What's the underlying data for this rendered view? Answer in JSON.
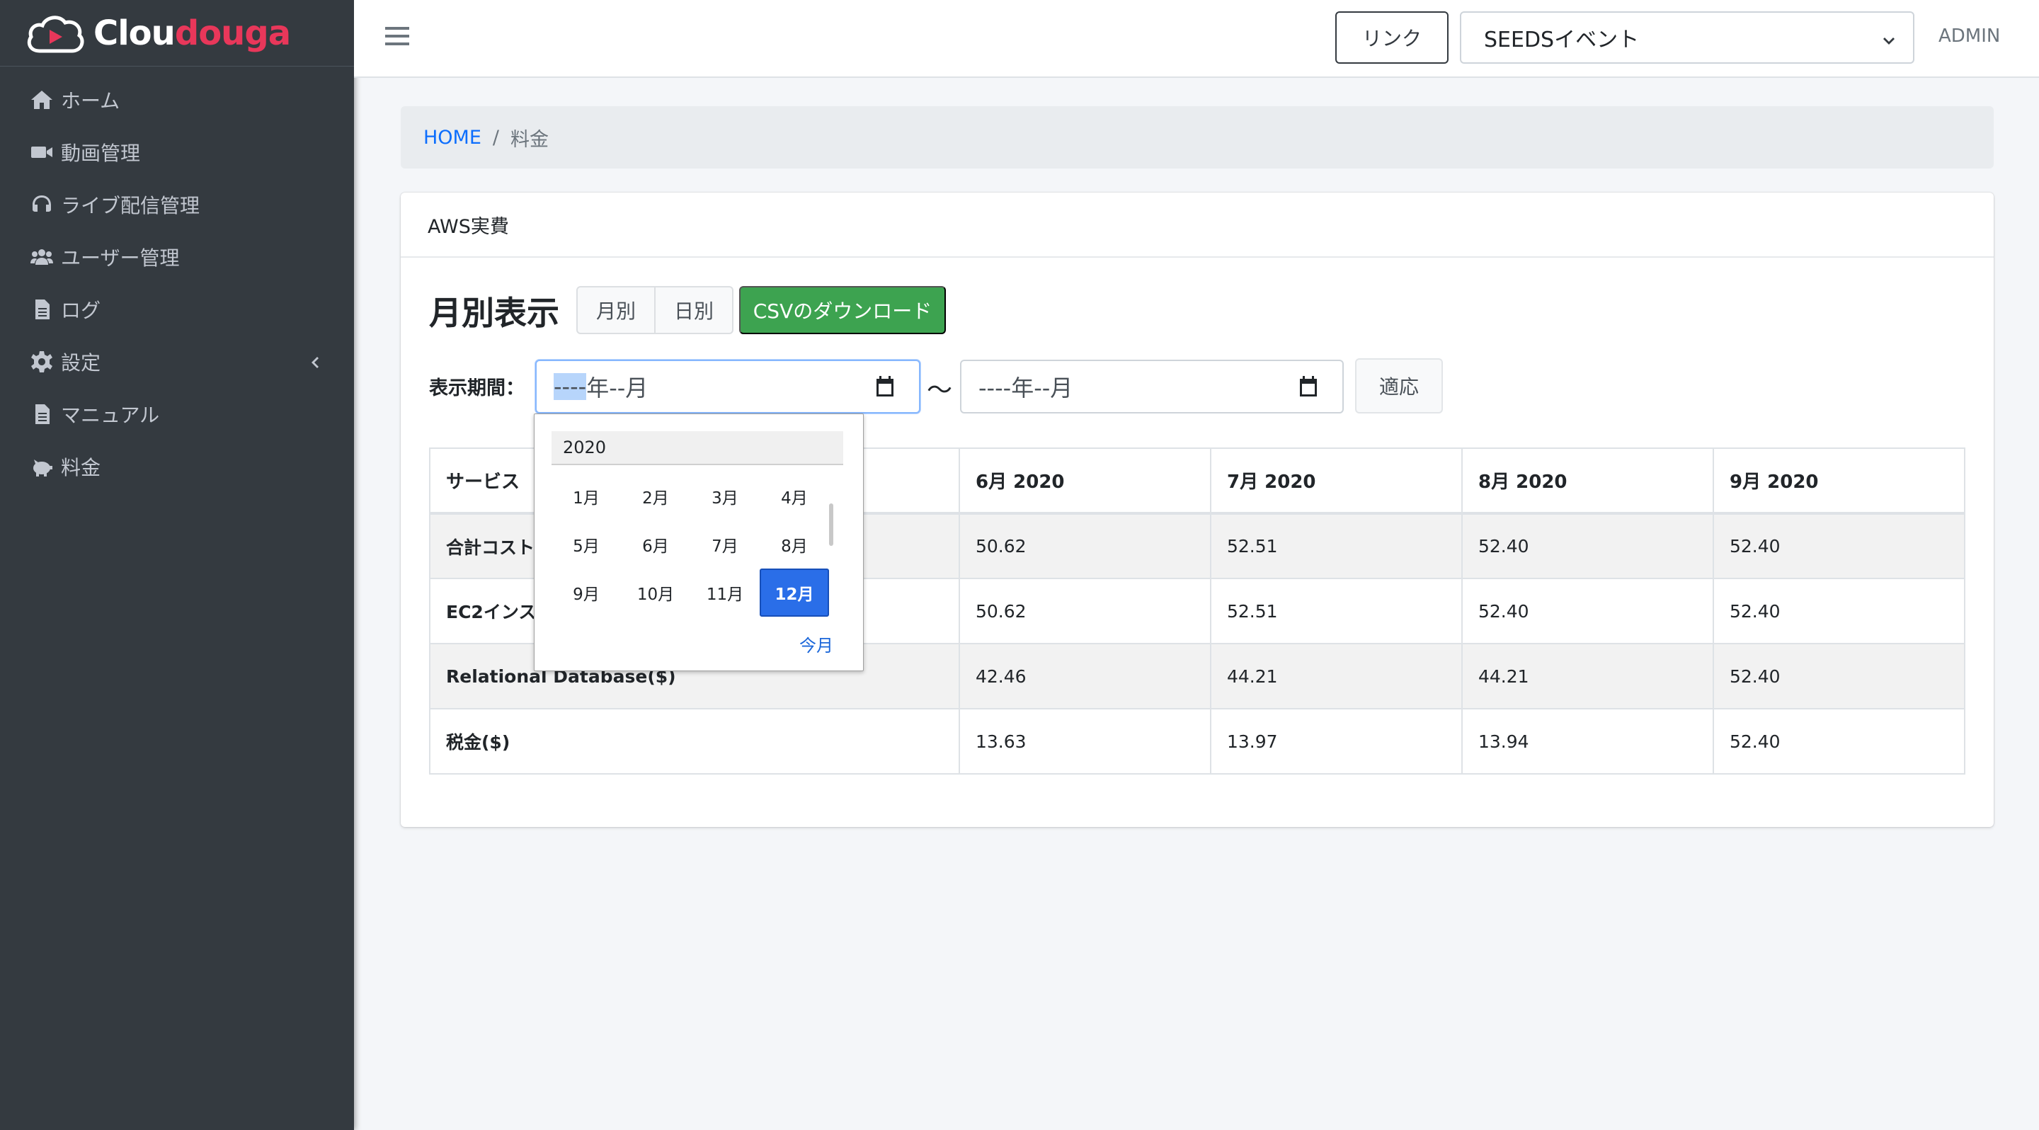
{
  "brand": {
    "name_part1": "Clou",
    "name_part2": "douga"
  },
  "sidebar": {
    "items": [
      {
        "label": "ホーム",
        "icon": "home-icon"
      },
      {
        "label": "動画管理",
        "icon": "video-icon"
      },
      {
        "label": "ライブ配信管理",
        "icon": "headset-icon"
      },
      {
        "label": "ユーザー管理",
        "icon": "users-icon"
      },
      {
        "label": "ログ",
        "icon": "file-icon"
      },
      {
        "label": "設定",
        "icon": "gear-icon"
      },
      {
        "label": "マニュアル",
        "icon": "file-icon"
      },
      {
        "label": "料金",
        "icon": "piggy-bank-icon"
      }
    ]
  },
  "header": {
    "link_label": "リンク",
    "event_select_value": "SEEDSイベント",
    "user_label": "ADMIN"
  },
  "breadcrumb": {
    "home": "HOME",
    "separator": "/",
    "current": "料金"
  },
  "card": {
    "header_title": "AWS実費",
    "section_title": "月別表示",
    "toggle_monthly": "月別",
    "toggle_daily": "日別",
    "csv_button": "CSVのダウンロード",
    "period_label": "表示期間：",
    "start_input_year_placeholder": "----",
    "start_input_rest": "年--月",
    "end_input_value": "----年--月",
    "tilde": "〜",
    "apply_button": "適応"
  },
  "table": {
    "headers": [
      "サービス",
      "6月 2020",
      "7月 2020",
      "8月 2020",
      "9月 2020"
    ],
    "rows": [
      {
        "label": "合計コスト",
        "values": [
          "50.62",
          "52.51",
          "52.40",
          "52.40"
        ]
      },
      {
        "label": "EC2インス",
        "values": [
          "50.62",
          "52.51",
          "52.40",
          "52.40"
        ]
      },
      {
        "label": "Relational Database($)",
        "values": [
          "42.46",
          "44.21",
          "44.21",
          "52.40"
        ]
      },
      {
        "label": "税金($)",
        "values": [
          "13.63",
          "13.97",
          "13.94",
          "52.40"
        ]
      }
    ]
  },
  "month_picker": {
    "year": "2020",
    "months": [
      "1月",
      "2月",
      "3月",
      "4月",
      "5月",
      "6月",
      "7月",
      "8月",
      "9月",
      "10月",
      "11月",
      "12月"
    ],
    "selected": "12月",
    "this_month": "今月"
  }
}
